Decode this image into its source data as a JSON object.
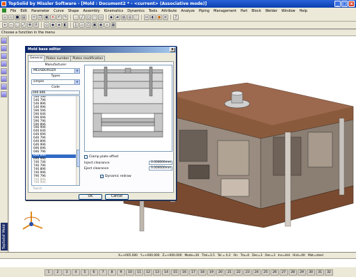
{
  "window": {
    "title": "TopSolid by Missler Software - [Mold : Document2 * - <current> (Associative mode)]",
    "min": "_",
    "max": "□",
    "close": "x"
  },
  "menubar": [
    "File",
    "Edit",
    "Parameter",
    "Curve",
    "Shape",
    "Assembly",
    "Kinematics",
    "Dynamics",
    "Tools",
    "Attribute",
    "Analyze",
    "Piping",
    "Management",
    "Part",
    "Block",
    "Welder",
    "Window",
    "Help"
  ],
  "hint": "Choose a function in the menu",
  "brand": "TopSolid' Mold",
  "dialog": {
    "title": "Mold base editor",
    "close": "x",
    "tabs": [
      "General",
      "Plates number",
      "Plates modification"
    ],
    "manufacturer_label": "Manufacturer",
    "manufacturer_value": "MEUSBURGER",
    "types_label": "Types",
    "types_value": "simple",
    "code_label": "Code",
    "code_input": "696 896",
    "codes": [
      "546 596",
      "546 796",
      "546 896",
      "546 996",
      "596 596",
      "596 646",
      "596 696",
      "596 796",
      "596 896",
      "596 996",
      "646 646",
      "646 696",
      "646 796",
      "646 896",
      "646 996",
      "696 696",
      "696 796",
      "696 896",
      "696 996",
      "746 746",
      "746 796",
      "746 896",
      "746 996",
      "796 796",
      "796 896",
      "796 996"
    ],
    "selected_code": "696 896",
    "pick_label": "Topick",
    "clamp_label": "Clamp plate offset",
    "inject_label": "Inject clearance",
    "inject_value": "0.000000mm",
    "eject_label": "Eject clearance",
    "eject_value": "0.000000mm",
    "dynamic_label": "Dynamic redraw",
    "ok": "OK",
    "cancel": "Cancel"
  },
  "status": [
    "X=+005.000",
    "Y=+000.000",
    "Z=+000.000",
    "Mode=30",
    "Ttol=3.5",
    "Tol = 0.2",
    "On",
    "Tra=0",
    "Dec=3",
    "Dec=3",
    "Inv=Hst",
    "Hist=Alt",
    "Mat=steel"
  ],
  "fkeys": [
    "1",
    "2",
    "3",
    "4",
    "5",
    "6",
    "7",
    "8",
    "9",
    "10",
    "11",
    "12",
    "13",
    "14",
    "15",
    "16",
    "17",
    "18",
    "19",
    "20",
    "21",
    "22",
    "23",
    "24",
    "25",
    "26",
    "27",
    "28",
    "29",
    "30",
    "31",
    "32"
  ],
  "colors": {
    "title_blue": "#0a3fb0",
    "selection": "#316ac5",
    "mold_brown": "#8a5a3c"
  }
}
